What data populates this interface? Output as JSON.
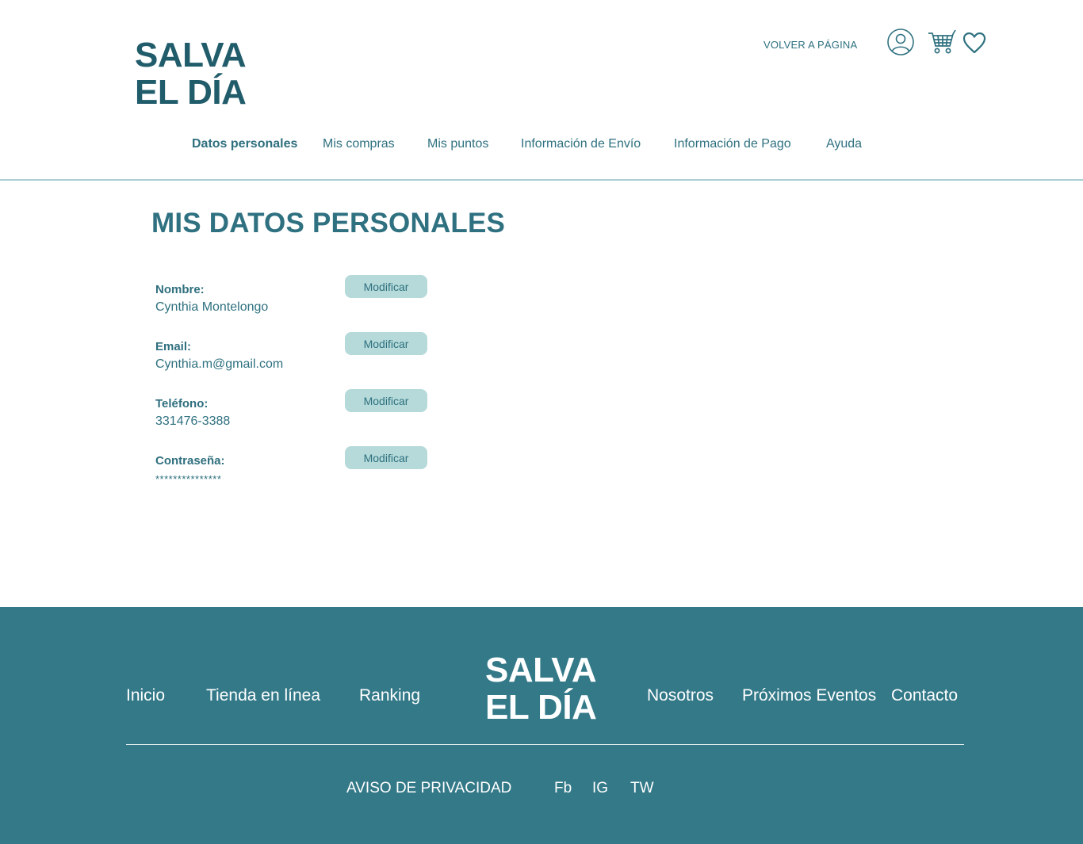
{
  "header": {
    "logo_line1": "SALVA",
    "logo_line2": "EL DÍA",
    "back_link": "VOLVER A PÁGINA",
    "icons": [
      "user-icon",
      "cart-icon",
      "heart-icon"
    ]
  },
  "nav": {
    "items": [
      {
        "label": "Datos personales",
        "active": true
      },
      {
        "label": "Mis compras"
      },
      {
        "label": "Mis puntos"
      },
      {
        "label": "Información de Envío"
      },
      {
        "label": "Información de Pago"
      },
      {
        "label": "Ayuda"
      }
    ]
  },
  "main": {
    "title": "MIS DATOS PERSONALES",
    "fields": [
      {
        "label": "Nombre:",
        "value": "Cynthia Montelongo",
        "button": "Modificar"
      },
      {
        "label": "Email:",
        "value": "Cynthia.m@gmail.com",
        "button": "Modificar"
      },
      {
        "label": "Teléfono:",
        "value": "331476-3388",
        "button": "Modificar"
      },
      {
        "label": "Contraseña:",
        "value": "***************",
        "button": "Modificar"
      }
    ]
  },
  "footer": {
    "nav_left": [
      "Inicio",
      "Tienda en línea",
      "Ranking"
    ],
    "logo_line1": "SALVA",
    "logo_line2": "EL DÍA",
    "nav_right": [
      "Nosotros",
      "Próximos Eventos",
      "Contacto"
    ],
    "privacy": "AVISO DE PRIVACIDAD",
    "social": [
      "Fb",
      "IG",
      "TW"
    ]
  },
  "colors": {
    "primary": "#2f7180",
    "logo": "#215c6b",
    "button_bg": "#b5dad9",
    "footer_bg": "#337988"
  }
}
